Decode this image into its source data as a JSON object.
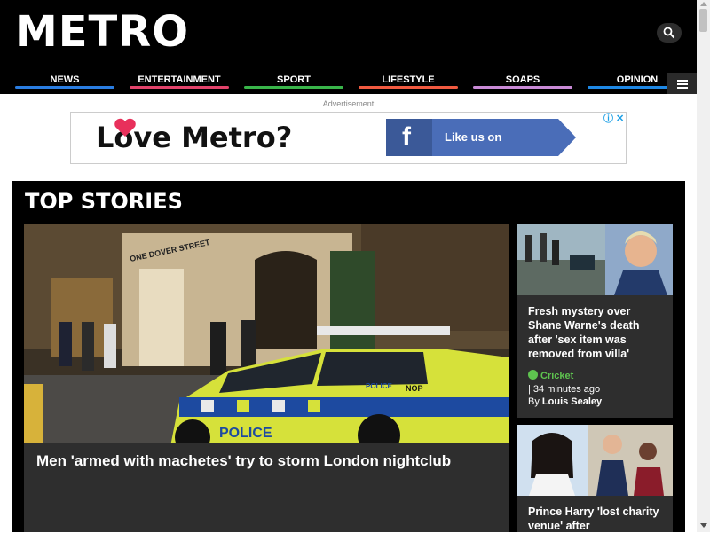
{
  "header": {
    "logo": "METRO",
    "nav": [
      {
        "label": "NEWS",
        "color": "#2a7de1"
      },
      {
        "label": "ENTERTAINMENT",
        "color": "#e2436b"
      },
      {
        "label": "SPORT",
        "color": "#39b54a"
      },
      {
        "label": "LIFESTYLE",
        "color": "#f15a40"
      },
      {
        "label": "SOAPS",
        "color": "#c98ad6"
      },
      {
        "label": "OPINION",
        "color": "#1e88e5"
      }
    ]
  },
  "ad": {
    "label": "Advertisement",
    "headline": "Love Metro?",
    "fb_label": "Like us on Facebook",
    "fb_letter": "f"
  },
  "top_stories": {
    "title": "TOP STORIES",
    "main": {
      "headline": "Men 'armed with machetes' try to storm London nightclub",
      "image_text": [
        "ONE DOVER STREET",
        "POLICE",
        "POLICE",
        "NOP"
      ]
    },
    "side": [
      {
        "headline": "Fresh mystery over Shane Warne's death after 'sex item was removed from villa'",
        "category": "Cricket",
        "time": "| 34 minutes ago",
        "byline_prefix": "By",
        "author": "Louis Sealey"
      },
      {
        "headline": "Prince Harry 'lost charity venue' after"
      }
    ]
  },
  "colors": {
    "header_bg": "#000000",
    "card_bg": "#2e2e2e",
    "category_green": "#5ec34f",
    "facebook_blue": "#3b5998"
  }
}
